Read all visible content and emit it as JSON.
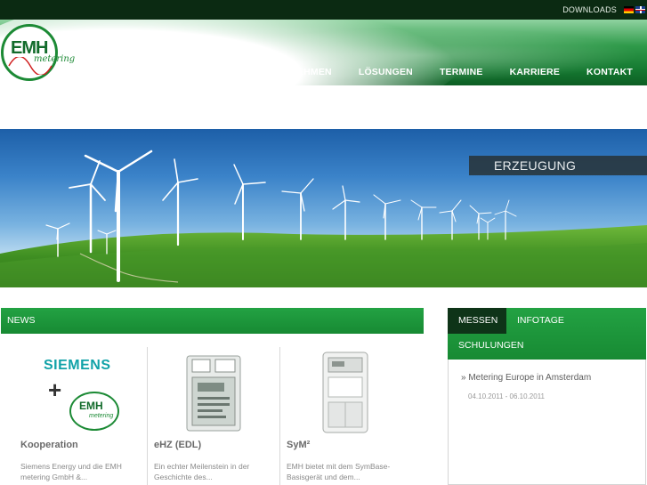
{
  "topbar": {
    "downloads": "DOWNLOADS"
  },
  "logo": {
    "name": "EMH",
    "sub": "metering"
  },
  "nav": {
    "items": [
      "UNTERNEHMEN",
      "LÖSUNGEN",
      "TERMINE",
      "KARRIERE",
      "KONTAKT"
    ]
  },
  "banner": {
    "label": "ERZEUGUNG"
  },
  "news": {
    "header": "NEWS",
    "cards": [
      {
        "title": "Kooperation",
        "text": "Siemens Energy und die EMH metering GmbH &...",
        "brand": "SIEMENS",
        "plus": "+",
        "logo_name": "EMH",
        "logo_sub": "metering"
      },
      {
        "title": "eHZ (EDL)",
        "text": "Ein echter Meilenstein in der Geschichte des..."
      },
      {
        "title": "SyM²",
        "text": "EMH bietet mit dem SymBase-Basisgerät und dem..."
      }
    ]
  },
  "tabs": {
    "items": [
      "MESSEN",
      "INFOTAGE",
      "SCHULUNGEN"
    ],
    "active": "MESSEN"
  },
  "event": {
    "title": "» Metering Europe in Amsterdam",
    "date": "04.10.2011 - 06.10.2011"
  },
  "colors": {
    "brand_green": "#178a33",
    "dark_green": "#0b2a12",
    "siemens_teal": "#11a2a8"
  }
}
